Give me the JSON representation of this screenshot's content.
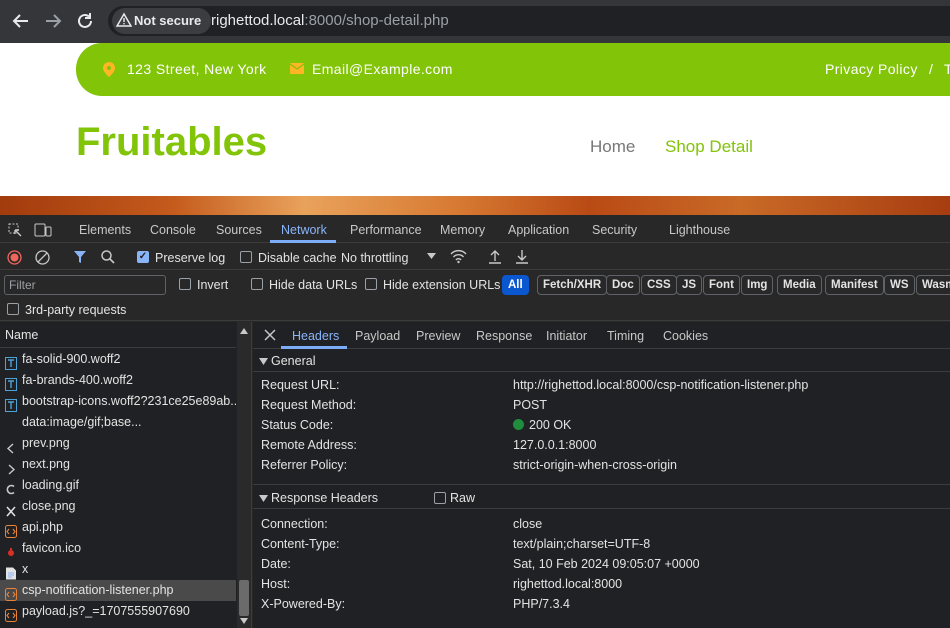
{
  "browser": {
    "back_icon": "arrow-left-icon",
    "forward_icon": "arrow-right-icon",
    "reload_icon": "reload-icon",
    "security_label": "Not secure",
    "url_host": "righettod.local",
    "url_rest": ":8000/shop-detail.php"
  },
  "page": {
    "address": "123 Street, New York",
    "email": "Email@Example.com",
    "privacy": "Privacy Policy",
    "sep": "/",
    "next_link": "T",
    "brand": "Fruitables",
    "nav": [
      "Home",
      "Shop Detail"
    ],
    "colors": {
      "accent": "#81c408",
      "active_nav": "#81c408"
    }
  },
  "devtools": {
    "tabs": [
      "Elements",
      "Console",
      "Sources",
      "Network",
      "Performance",
      "Memory",
      "Application",
      "Security",
      "Lighthouse"
    ],
    "active_tab": "Network",
    "preserve_log": "Preserve log",
    "disable_cache": "Disable cache",
    "throttling": "No throttling",
    "filter_placeholder": "Filter",
    "invert": "Invert",
    "hide_data_urls": "Hide data URLs",
    "hide_extension_urls": "Hide extension URLs",
    "filter_types": [
      "All",
      "Fetch/XHR",
      "Doc",
      "CSS",
      "JS",
      "Font",
      "Img",
      "Media",
      "Manifest",
      "WS",
      "Wasm"
    ],
    "third_party": "3rd-party requests",
    "name_header": "Name",
    "requests": [
      {
        "name": "fa-solid-900.woff2",
        "icon": "font-file-icon"
      },
      {
        "name": "fa-brands-400.woff2",
        "icon": "font-file-icon"
      },
      {
        "name": "bootstrap-icons.woff2?231ce25e89ab...",
        "icon": "font-file-icon"
      },
      {
        "name": "data:image/gif;base...",
        "icon": ""
      },
      {
        "name": "prev.png",
        "icon": "chevron-left-icon"
      },
      {
        "name": "next.png",
        "icon": "chevron-right-icon"
      },
      {
        "name": "loading.gif",
        "icon": "spinner-icon"
      },
      {
        "name": "close.png",
        "icon": "close-icon"
      },
      {
        "name": "api.php",
        "icon": "script-icon"
      },
      {
        "name": "favicon.ico",
        "icon": "favicon-icon"
      },
      {
        "name": "x",
        "icon": "document-icon"
      },
      {
        "name": "csp-notification-listener.php",
        "icon": "script-icon"
      },
      {
        "name": "payload.js?_=1707555907690",
        "icon": "script-icon"
      }
    ],
    "detail_tabs": [
      "Headers",
      "Payload",
      "Preview",
      "Response",
      "Initiator",
      "Timing",
      "Cookies"
    ],
    "general_title": "General",
    "general": [
      {
        "k": "Request URL:",
        "v": "http://righettod.local:8000/csp-notification-listener.php"
      },
      {
        "k": "Request Method:",
        "v": "POST"
      },
      {
        "k": "Status Code:",
        "v": "200 OK"
      },
      {
        "k": "Remote Address:",
        "v": "127.0.0.1:8000"
      },
      {
        "k": "Referrer Policy:",
        "v": "strict-origin-when-cross-origin"
      }
    ],
    "response_title": "Response Headers",
    "raw_label": "Raw",
    "response": [
      {
        "k": "Connection:",
        "v": "close"
      },
      {
        "k": "Content-Type:",
        "v": "text/plain;charset=UTF-8"
      },
      {
        "k": "Date:",
        "v": "Sat, 10 Feb 2024 09:05:07 +0000"
      },
      {
        "k": "Host:",
        "v": "righettod.local:8000"
      },
      {
        "k": "X-Powered-By:",
        "v": "PHP/7.3.4"
      }
    ]
  }
}
